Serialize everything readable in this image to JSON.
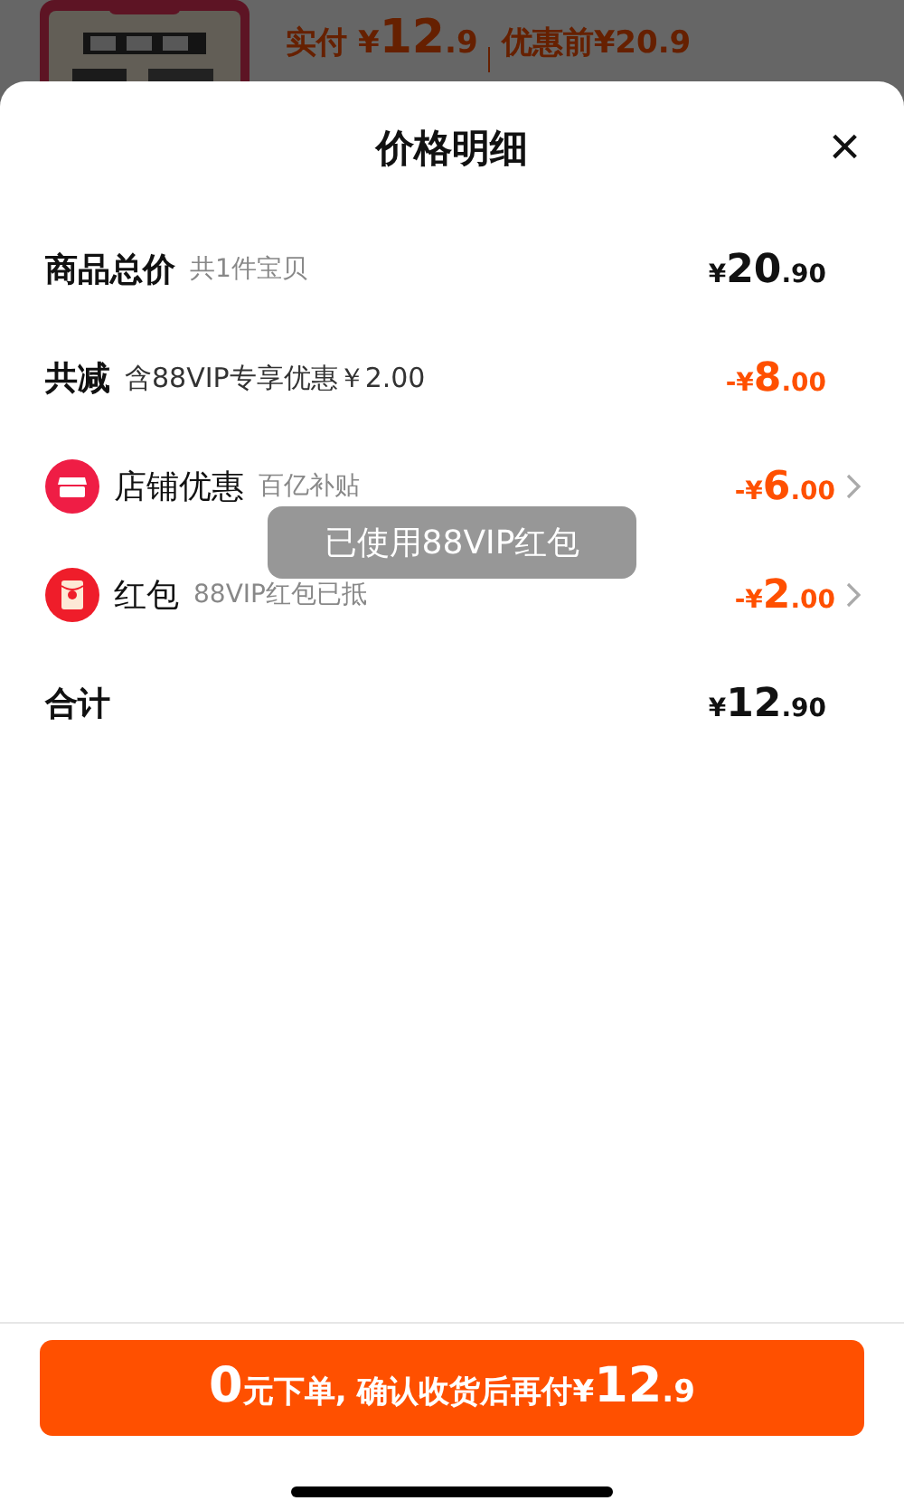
{
  "background_product": {
    "kind": "picture",
    "paid_label": "实付",
    "paid_price": {
      "currency": "¥",
      "integer": "12",
      "decimal": ".9"
    },
    "before_label": "优惠前¥20.9"
  },
  "sheet": {
    "title": "价格明细",
    "close": "×"
  },
  "rows": [
    {
      "kind": "total",
      "label": "商品总价",
      "note": "共1件宝贝",
      "amount": {
        "currency": "¥",
        "integer": "20",
        "decimal": ".90"
      }
    },
    {
      "kind": "reduction",
      "label": "共减",
      "note": "含88VIP专享优惠￥2.00",
      "amount": {
        "sign": "-",
        "currency": "¥",
        "integer": "8",
        "decimal": ".00"
      }
    },
    {
      "kind": "store",
      "label": "店铺优惠",
      "note": "百亿补贴",
      "amount": {
        "sign": "-",
        "currency": "¥",
        "integer": "6",
        "decimal": ".00"
      }
    },
    {
      "kind": "packet",
      "label": "红包",
      "note": "88VIP红包已抵",
      "amount": {
        "sign": "-",
        "currency": "¥",
        "integer": "2",
        "decimal": ".00"
      }
    },
    {
      "kind": "sum",
      "label": "合计",
      "amount": {
        "currency": "¥",
        "integer": "12",
        "decimal": ".90"
      }
    }
  ],
  "toast": "已使用88VIP红包",
  "submit": {
    "lead": "0",
    "text": "元下单, 确认收货后再付",
    "currency": "¥",
    "integer": "12",
    "decimal": ".9"
  }
}
